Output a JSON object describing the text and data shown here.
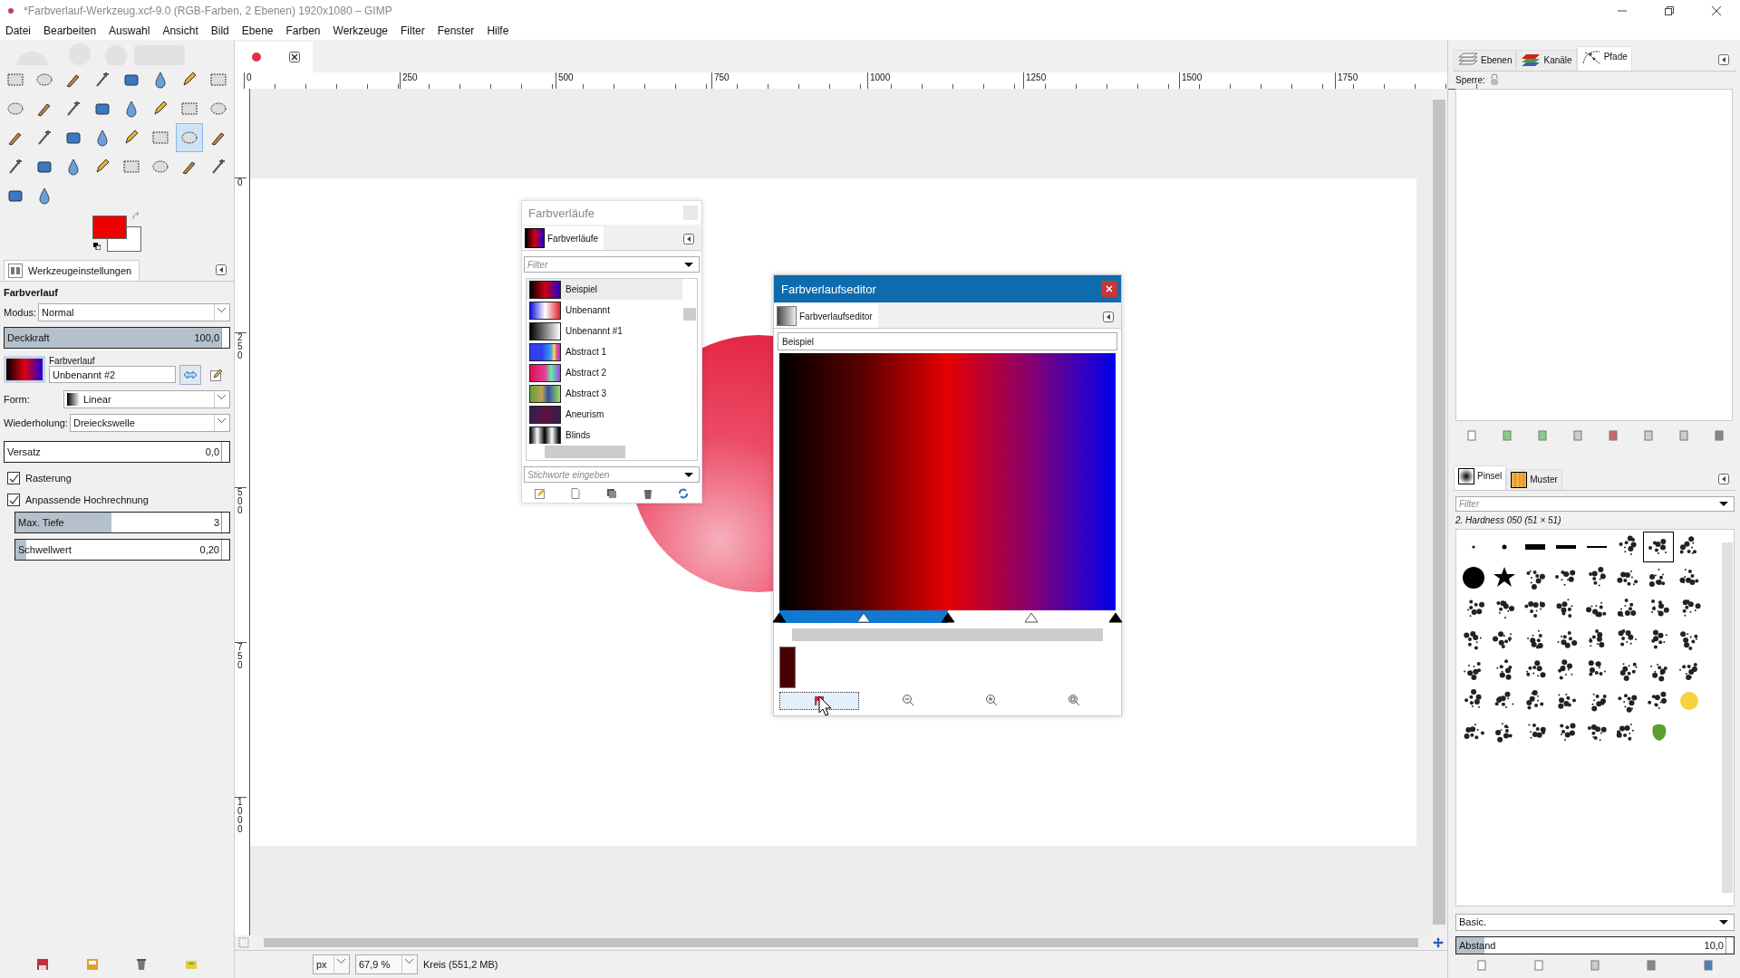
{
  "window": {
    "title": "*Farbverlauf-Werkzeug.xcf-9.0 (RGB-Farben, 2 Ebenen) 1920x1080 – GIMP"
  },
  "menu": [
    "Datei",
    "Bearbeiten",
    "Auswahl",
    "Ansicht",
    "Bild",
    "Ebene",
    "Farben",
    "Werkzeuge",
    "Filter",
    "Fenster",
    "Hilfe"
  ],
  "toolbox": {
    "tools": [
      {
        "selected": false
      },
      {
        "selected": false
      },
      {
        "selected": false
      },
      {
        "selected": false
      },
      {
        "selected": false
      },
      {
        "selected": false
      },
      {
        "selected": false
      },
      {
        "selected": false
      },
      {
        "selected": false
      },
      {
        "selected": false
      },
      {
        "selected": false
      },
      {
        "selected": false
      },
      {
        "selected": false
      },
      {
        "selected": false
      },
      {
        "selected": false
      },
      {
        "selected": false
      },
      {
        "selected": false
      },
      {
        "selected": false
      },
      {
        "selected": false
      },
      {
        "selected": false
      },
      {
        "selected": false
      },
      {
        "selected": false
      },
      {
        "selected": true
      },
      {
        "selected": false
      },
      {
        "selected": false
      },
      {
        "selected": false
      },
      {
        "selected": false
      },
      {
        "selected": false
      },
      {
        "selected": false
      },
      {
        "selected": false
      },
      {
        "selected": false
      },
      {
        "selected": false
      },
      {
        "selected": false
      },
      {
        "selected": false
      }
    ]
  },
  "tool_options": {
    "tab": "Werkzeugeinstellungen",
    "title": "Farbverlauf",
    "mode": {
      "label": "Modus:",
      "value": "Normal"
    },
    "opacity": {
      "label": "Deckkraft",
      "value": "100,0",
      "level": 1
    },
    "gradient": {
      "label": "Farbverlauf",
      "name": "Unbenannt #2"
    },
    "shape": {
      "label": "Form:",
      "value": "Linear"
    },
    "repeat": {
      "label": "Wiederholung:",
      "value": "Dreieckswelle"
    },
    "offset": {
      "label": "Versatz",
      "value": "0,0",
      "level": 0
    },
    "checks": [
      {
        "label": "Rasterung",
        "checked": true
      },
      {
        "label": "Anpassende Hochrechnung",
        "checked": true
      }
    ],
    "max_depth": {
      "label": "Max. Tiefe",
      "value": "3",
      "level": 0.45
    },
    "threshold": {
      "label": "Schwellwert",
      "value": "0,20",
      "level": 0.05
    }
  },
  "rulers": {
    "horizontal": [
      "0",
      "250",
      "500",
      "750",
      "1000",
      "1250",
      "1500",
      "1750"
    ],
    "vertical": [
      "0",
      "250",
      "500",
      "750",
      "1000"
    ]
  },
  "gradients_dialog": {
    "title": "Farbverläufe",
    "tab": "Farbverläufe",
    "filter": {
      "placeholder": "Filter"
    },
    "items": [
      {
        "name": "Beispiel",
        "selected": true
      },
      {
        "name": "Unbenannt",
        "selected": false
      },
      {
        "name": "Unbenannt #1",
        "selected": false
      },
      {
        "name": "Abstract 1",
        "selected": false
      },
      {
        "name": "Abstract 2",
        "selected": false
      },
      {
        "name": "Abstract 3",
        "selected": false
      },
      {
        "name": "Aneurism",
        "selected": false
      },
      {
        "name": "Blinds",
        "selected": false
      }
    ],
    "tags": {
      "placeholder": "Stichworte eingeben"
    }
  },
  "gradient_editor": {
    "title": "Farbverlaufseditor",
    "tab": "Farbverlaufseditor",
    "name": "Beispiel",
    "segments": [
      {
        "selected": true
      },
      {
        "selected": true
      },
      {
        "selected": false
      },
      {
        "selected": false
      }
    ]
  },
  "right_panel": {
    "tabs": [
      {
        "label": "Ebenen",
        "selected": false
      },
      {
        "label": "Kanäle",
        "selected": false
      },
      {
        "label": "Pfade",
        "selected": true
      }
    ],
    "lock_label": "Sperre:",
    "brush_tabs": [
      {
        "label": "Pinsel",
        "selected": true
      },
      {
        "label": "Muster",
        "selected": false
      }
    ],
    "filter": {
      "placeholder": "Filter"
    },
    "brush_name": "2. Hardness 050 (51 × 51)",
    "brushes": [
      {
        "selected": false
      },
      {
        "selected": false
      },
      {
        "selected": false
      },
      {
        "selected": false
      },
      {
        "selected": false
      },
      {
        "selected": false
      },
      {
        "selected": true
      },
      {
        "selected": false
      },
      {
        "selected": false
      },
      {
        "selected": false
      },
      {
        "selected": false
      },
      {
        "selected": false
      },
      {
        "selected": false
      },
      {
        "selected": false
      },
      {
        "selected": false
      },
      {
        "selected": false
      },
      {
        "selected": false
      },
      {
        "selected": false
      },
      {
        "selected": false
      },
      {
        "selected": false
      },
      {
        "selected": false
      },
      {
        "selected": false
      },
      {
        "selected": false
      },
      {
        "selected": false
      },
      {
        "selected": false
      },
      {
        "selected": false
      },
      {
        "selected": false
      },
      {
        "selected": false
      },
      {
        "selected": false
      },
      {
        "selected": false
      },
      {
        "selected": false
      },
      {
        "selected": false
      },
      {
        "selected": false
      },
      {
        "selected": false
      },
      {
        "selected": false
      },
      {
        "selected": false
      },
      {
        "selected": false
      },
      {
        "selected": false
      },
      {
        "selected": false
      },
      {
        "selected": false
      },
      {
        "selected": false
      },
      {
        "selected": false
      },
      {
        "selected": false
      },
      {
        "selected": false
      },
      {
        "selected": false
      },
      {
        "selected": false
      },
      {
        "selected": false
      },
      {
        "selected": false
      },
      {
        "selected": false
      },
      {
        "selected": false
      },
      {
        "selected": false
      },
      {
        "selected": false
      },
      {
        "selected": false
      },
      {
        "selected": false
      },
      {
        "selected": false
      }
    ],
    "preset": "Basic.",
    "spacing": {
      "label": "Abstand",
      "value": "10,0",
      "level": 0.1
    }
  },
  "status": {
    "unit": "px",
    "zoom": "67,9 %",
    "info": "Kreis (551,2 MB)"
  }
}
